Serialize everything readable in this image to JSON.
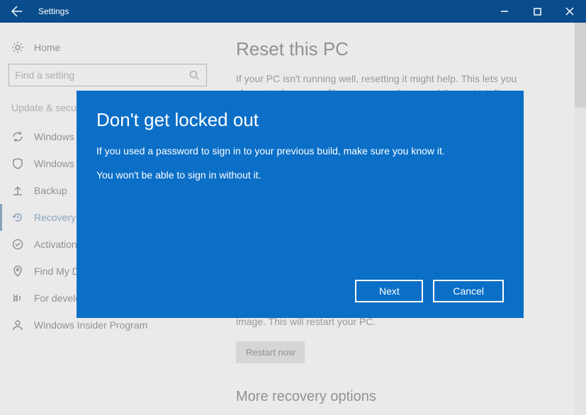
{
  "titlebar": {
    "title": "Settings"
  },
  "sidebar": {
    "home": "Home",
    "search_placeholder": "Find a setting",
    "category": "Update & security",
    "items": [
      {
        "label": "Windows Update"
      },
      {
        "label": "Windows Defender"
      },
      {
        "label": "Backup"
      },
      {
        "label": "Recovery"
      },
      {
        "label": "Activation"
      },
      {
        "label": "Find My Device"
      },
      {
        "label": "For developers"
      },
      {
        "label": "Windows Insider Program"
      }
    ]
  },
  "main": {
    "heading": "Reset this PC",
    "reset_text": "If your PC isn't running well, resetting it might help. This lets you choose to keep your files or remove them, and then reinstalls",
    "advanced_text": "Windows startup settings, or restore Windows from a system image. This will restart your PC.",
    "restart_label": "Restart now",
    "more_heading": "More recovery options"
  },
  "dialog": {
    "title": "Don't get locked out",
    "line1": "If you used a password to sign in to your previous build, make sure you know it.",
    "line2": "You won't be able to sign in without it.",
    "next": "Next",
    "cancel": "Cancel"
  }
}
